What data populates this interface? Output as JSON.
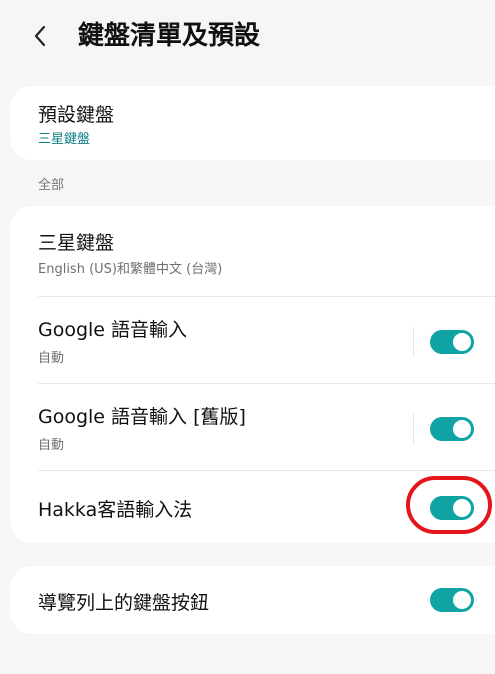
{
  "header": {
    "title": "鍵盤清單及預設"
  },
  "default_keyboard": {
    "title": "預設鍵盤",
    "value": "三星鍵盤"
  },
  "section": {
    "label": "全部"
  },
  "keyboards": [
    {
      "title": "三星鍵盤",
      "subtitle": "English (US)和繁體中文 (台灣)"
    },
    {
      "title": "Google 語音輸入",
      "subtitle": "自動",
      "enabled": true
    },
    {
      "title": "Google 語音輸入 [舊版]",
      "subtitle": "自動",
      "enabled": true
    },
    {
      "title": "Hakka客語輸入法",
      "enabled": true
    }
  ],
  "navbar_keyboard_button": {
    "title": "導覽列上的鍵盤按鈕",
    "enabled": true
  },
  "colors": {
    "toggle_on": "#0fa4a3",
    "accent_text": "#0e7f86",
    "annotation_ring": "#e4161b",
    "background": "#f6f6f6"
  },
  "icons": {
    "back": "chevron-left-icon"
  }
}
